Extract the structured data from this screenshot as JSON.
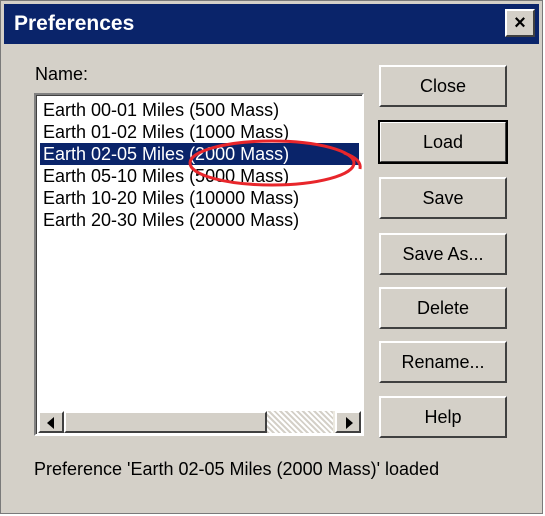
{
  "window": {
    "title": "Preferences",
    "close_glyph": "×"
  },
  "name_label": "Name:",
  "list": {
    "items": [
      "Earth 00-01 Miles (500 Mass)",
      "Earth 01-02 Miles (1000 Mass)",
      "Earth 02-05 Miles (2000 Mass)",
      "Earth 05-10 Miles (5000 Mass)",
      "Earth 10-20 Miles (10000 Mass)",
      "Earth 20-30 Miles (20000 Mass)"
    ],
    "selected_index": 2
  },
  "buttons": {
    "close": "Close",
    "load": "Load",
    "save": "Save",
    "save_as": "Save As...",
    "delete": "Delete",
    "rename": "Rename...",
    "help": "Help"
  },
  "status_text": "Preference 'Earth 02-05 Miles (2000 Mass)' loaded",
  "colors": {
    "title_bar": "#0a246a",
    "selection": "#0a246a",
    "annotation": "#e8262b"
  },
  "icons": {
    "close": "close-icon",
    "scroll_left": "arrow-left-icon",
    "scroll_right": "arrow-right-icon"
  }
}
